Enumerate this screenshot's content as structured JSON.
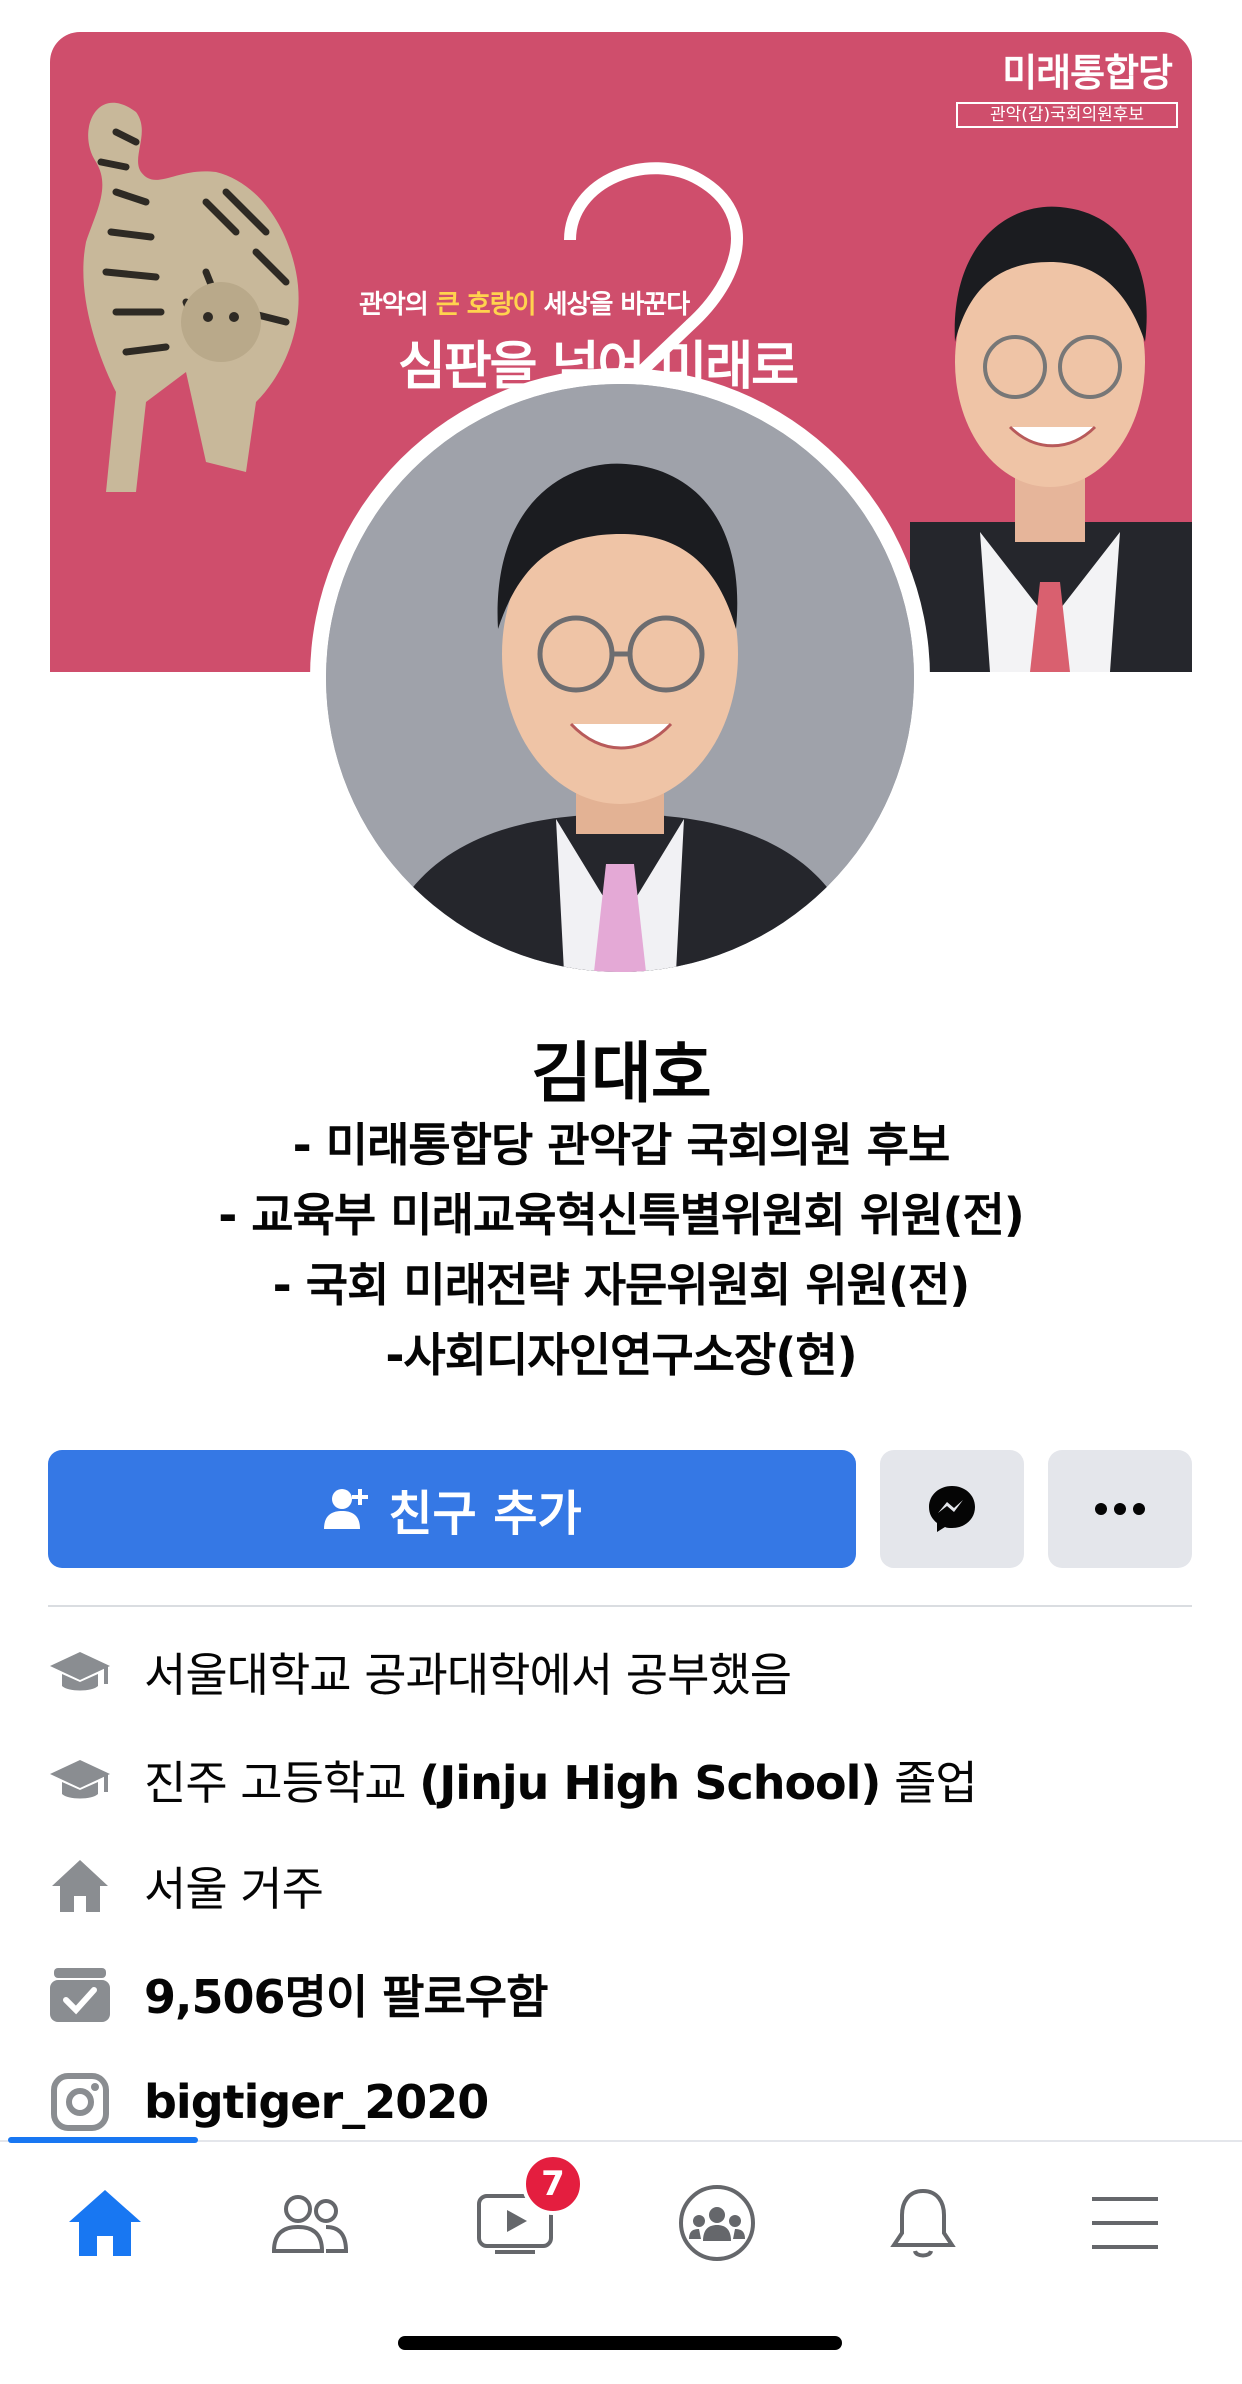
{
  "cover": {
    "party_name": "미래통합당",
    "party_subtitle": "관악(갑)국회의원후보",
    "slogan_small_pre": "관악의 ",
    "slogan_small_highlight": "큰 호랑이",
    "slogan_small_post": " 세상을 바꾼다",
    "slogan_big": "심판을 넘어 미래로",
    "number": "2"
  },
  "profile": {
    "name": "김대호",
    "bio": [
      "- 미래통합당 관악갑 국회의원 후보",
      "- 교육부 미래교육혁신특별위원회 위원(전)",
      "- 국회 미래전략 자문위원회 위원(전)",
      "-사회디자인연구소장(현)"
    ]
  },
  "actions": {
    "add_friend_label": "친구 추가",
    "message_icon": "messenger-icon",
    "more_icon": "more-icon"
  },
  "info": {
    "education1": "서울대학교 공과대학에서 공부했음",
    "education2_pre": "진주 고등학교 ",
    "education2_bold": "(Jinju High School)",
    "education2_post": " 졸업",
    "lives": "서울 거주",
    "followers": "9,506명이 팔로우함",
    "instagram": "bigtiger_2020"
  },
  "nav": {
    "tabs": [
      "home",
      "friends",
      "watch",
      "groups",
      "notifications",
      "menu"
    ],
    "watch_badge": "7",
    "active_color": "#1877f2",
    "inactive_color": "#65676b"
  },
  "colors": {
    "cover_bg": "#cf4e6c",
    "button_blue": "#3578e5",
    "button_gray": "#e4e6eb"
  }
}
